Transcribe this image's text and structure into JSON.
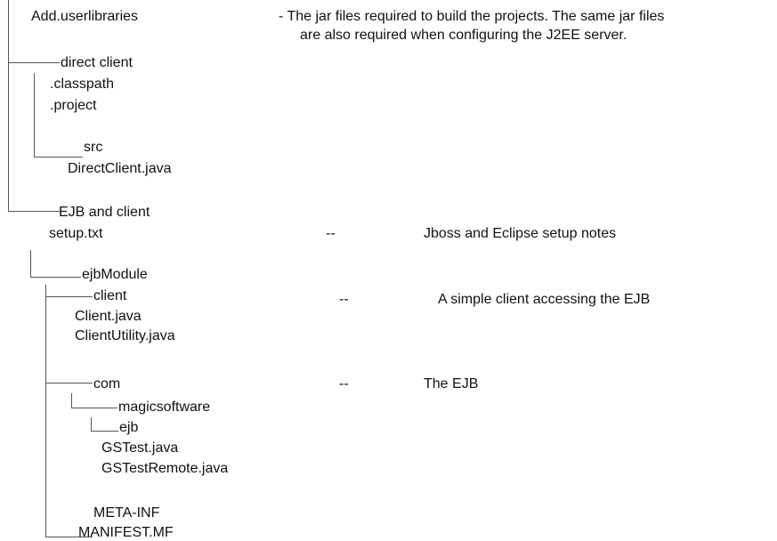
{
  "root_file": "Add.userlibraries",
  "root_note_line1": "- The jar files required to build the projects. The same jar files",
  "root_note_line2": "are also required when configuring the J2EE server.",
  "direct_client": {
    "folder": "direct client",
    "files": [
      ".classpath",
      ".project"
    ],
    "src": {
      "folder": "src",
      "files": [
        "DirectClient.java"
      ]
    }
  },
  "ejb_client": {
    "folder": "EJB and client",
    "setup_file": "setup.txt",
    "setup_dash": "--",
    "setup_note": "Jboss and Eclipse setup notes",
    "ejb_module": {
      "folder": "ejbModule",
      "client": {
        "folder": "client",
        "dash": "--",
        "note": "A simple client accessing the EJB",
        "files": [
          "Client.java",
          "ClientUtility.java"
        ]
      },
      "com": {
        "folder": "com",
        "dash": "--",
        "note": "The EJB",
        "magicsoftware": {
          "folder": "magicsoftware",
          "ejb": {
            "folder": "ejb",
            "files": [
              "GSTest.java",
              "GSTestRemote.java"
            ]
          }
        }
      },
      "meta_inf": {
        "folder": "META-INF",
        "files": [
          "MANIFEST.MF"
        ]
      }
    }
  }
}
